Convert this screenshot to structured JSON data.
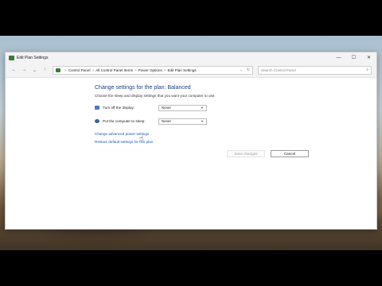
{
  "window": {
    "title": "Edit Plan Settings",
    "controls": {
      "minimize": "—",
      "maximize": "☐",
      "close": "✕"
    }
  },
  "nav": {
    "back": "←",
    "forward": "→",
    "recent": "⌄",
    "up": "↑",
    "breadcrumb": [
      "Control Panel",
      "All Control Panel Items",
      "Power Options",
      "Edit Plan Settings"
    ],
    "separator": ">",
    "dropdown": "⌄",
    "refresh": "↻",
    "search_placeholder": "Search Control Panel",
    "search_icon": "⌕"
  },
  "main": {
    "heading": "Change settings for the plan: Balanced",
    "subheading": "Choose the sleep and display settings that you want your computer to use.",
    "settings": [
      {
        "label": "Turn off the display:",
        "value": "Never",
        "icon": "monitor-icon"
      },
      {
        "label": "Put the computer to sleep:",
        "value": "Never",
        "icon": "sleep-icon"
      }
    ],
    "links": {
      "advanced": "Change advanced power settings",
      "restore": "Restore default settings for this plan"
    },
    "buttons": {
      "save": "Save changes",
      "cancel": "Cancel"
    }
  },
  "colors": {
    "heading": "#1e3f8a",
    "link": "#1a56c9"
  }
}
